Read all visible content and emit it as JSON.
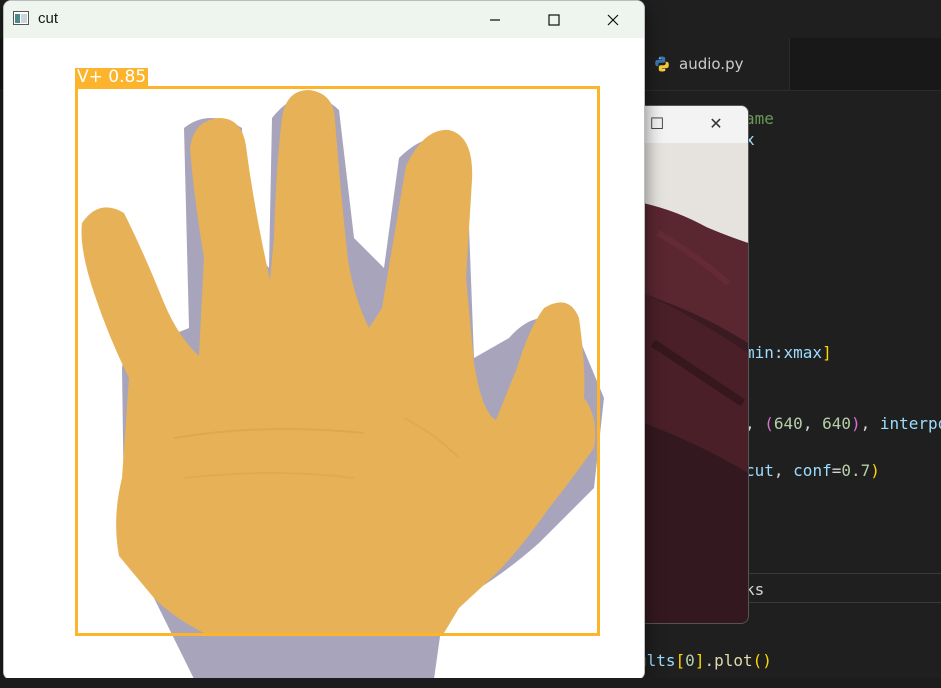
{
  "editor": {
    "tab_label": "audio.py",
    "tab_icon": "python-icon",
    "code_lines": [
      {
        "id": "l1",
        "segments": [
          {
            "t": "ame",
            "c": "c-comment"
          }
        ]
      },
      {
        "id": "l2",
        "segments": [
          {
            "t": "x",
            "c": "c-var"
          }
        ]
      },
      {
        "id": "l3",
        "segments": [
          {
            "t": "min:xmax",
            "c": "c-var"
          },
          {
            "t": "]",
            "c": "c-bracket"
          }
        ]
      },
      {
        "id": "l4",
        "segments": [
          {
            "t": ", ",
            "c": "c-white"
          },
          {
            "t": "(",
            "c": "c-paren"
          },
          {
            "t": "640",
            "c": "c-num"
          },
          {
            "t": ", ",
            "c": "c-white"
          },
          {
            "t": "640",
            "c": "c-num"
          },
          {
            "t": ")",
            "c": "c-paren"
          },
          {
            "t": ", ",
            "c": "c-white"
          },
          {
            "t": "interpo",
            "c": "c-var"
          }
        ]
      },
      {
        "id": "l5",
        "segments": [
          {
            "t": "cut",
            "c": "c-var"
          },
          {
            "t": ", ",
            "c": "c-white"
          },
          {
            "t": "conf",
            "c": "c-var"
          },
          {
            "t": "=",
            "c": "c-white"
          },
          {
            "t": "0.7",
            "c": "c-num"
          },
          {
            "t": ")",
            "c": "c-bracket"
          }
        ]
      },
      {
        "id": "l6",
        "segments": [
          {
            "t": "ks",
            "c": "c-white"
          }
        ]
      },
      {
        "id": "l7",
        "segments": [
          {
            "t": "ults",
            "c": "c-var"
          },
          {
            "t": "[",
            "c": "c-bracket"
          },
          {
            "t": "0",
            "c": "c-num"
          },
          {
            "t": "]",
            "c": "c-bracket"
          },
          {
            "t": ".",
            "c": "c-white"
          },
          {
            "t": "plot",
            "c": "c-fn"
          },
          {
            "t": "()",
            "c": "c-bracket"
          }
        ]
      }
    ]
  },
  "webcam_window": {
    "maximize_glyph": "☐",
    "close_glyph": "✕"
  },
  "cut_window": {
    "title": "cut",
    "minimize_icon": "minimize-icon",
    "maximize_icon": "maximize-icon",
    "close_icon": "close-icon",
    "detection": {
      "label": "V+ 0.85",
      "box_color": "#fbb42c",
      "hand_color": "#e7b257"
    }
  }
}
